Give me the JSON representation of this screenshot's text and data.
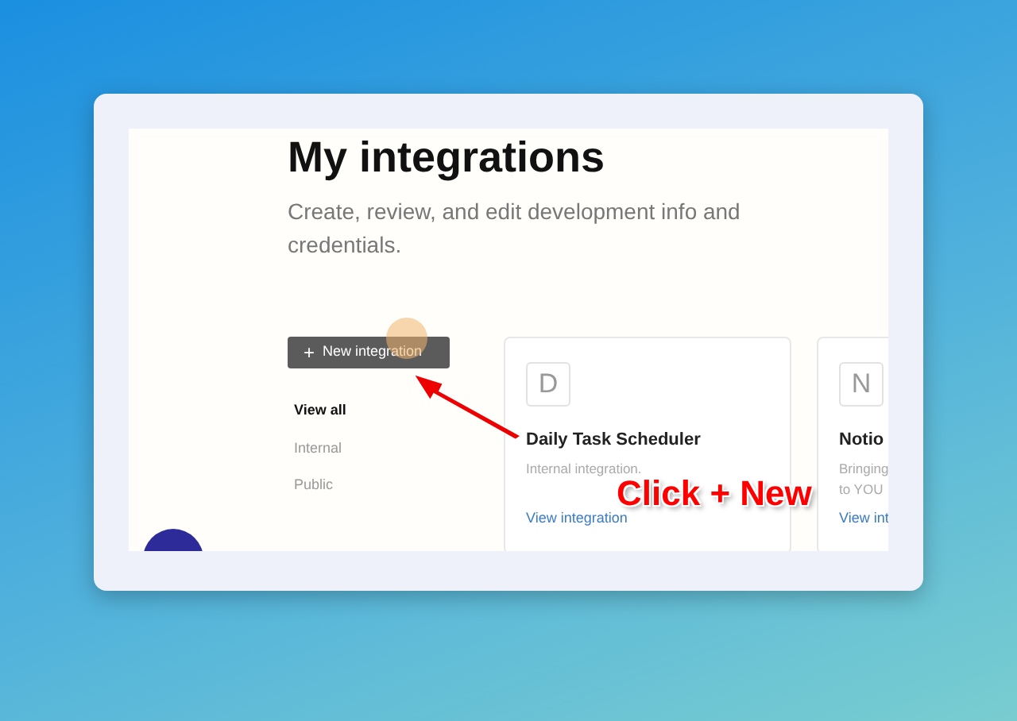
{
  "page": {
    "title": "My integrations",
    "subtitle": "Create, review, and edit development info and credentials."
  },
  "new_button": {
    "icon": "+",
    "label": "New integration"
  },
  "filters": [
    {
      "label": "View all",
      "selected": true
    },
    {
      "label": "Internal",
      "selected": false
    },
    {
      "label": "Public",
      "selected": false
    }
  ],
  "integrations": [
    {
      "letter": "D",
      "name": "Daily Task Scheduler",
      "description": [
        "Internal integration."
      ],
      "link": "View integration"
    },
    {
      "letter": "N",
      "name": "Notio",
      "description": [
        "Bringing",
        "to YOU"
      ],
      "link": "View int"
    }
  ],
  "annotation": {
    "label": "Click + New"
  }
}
